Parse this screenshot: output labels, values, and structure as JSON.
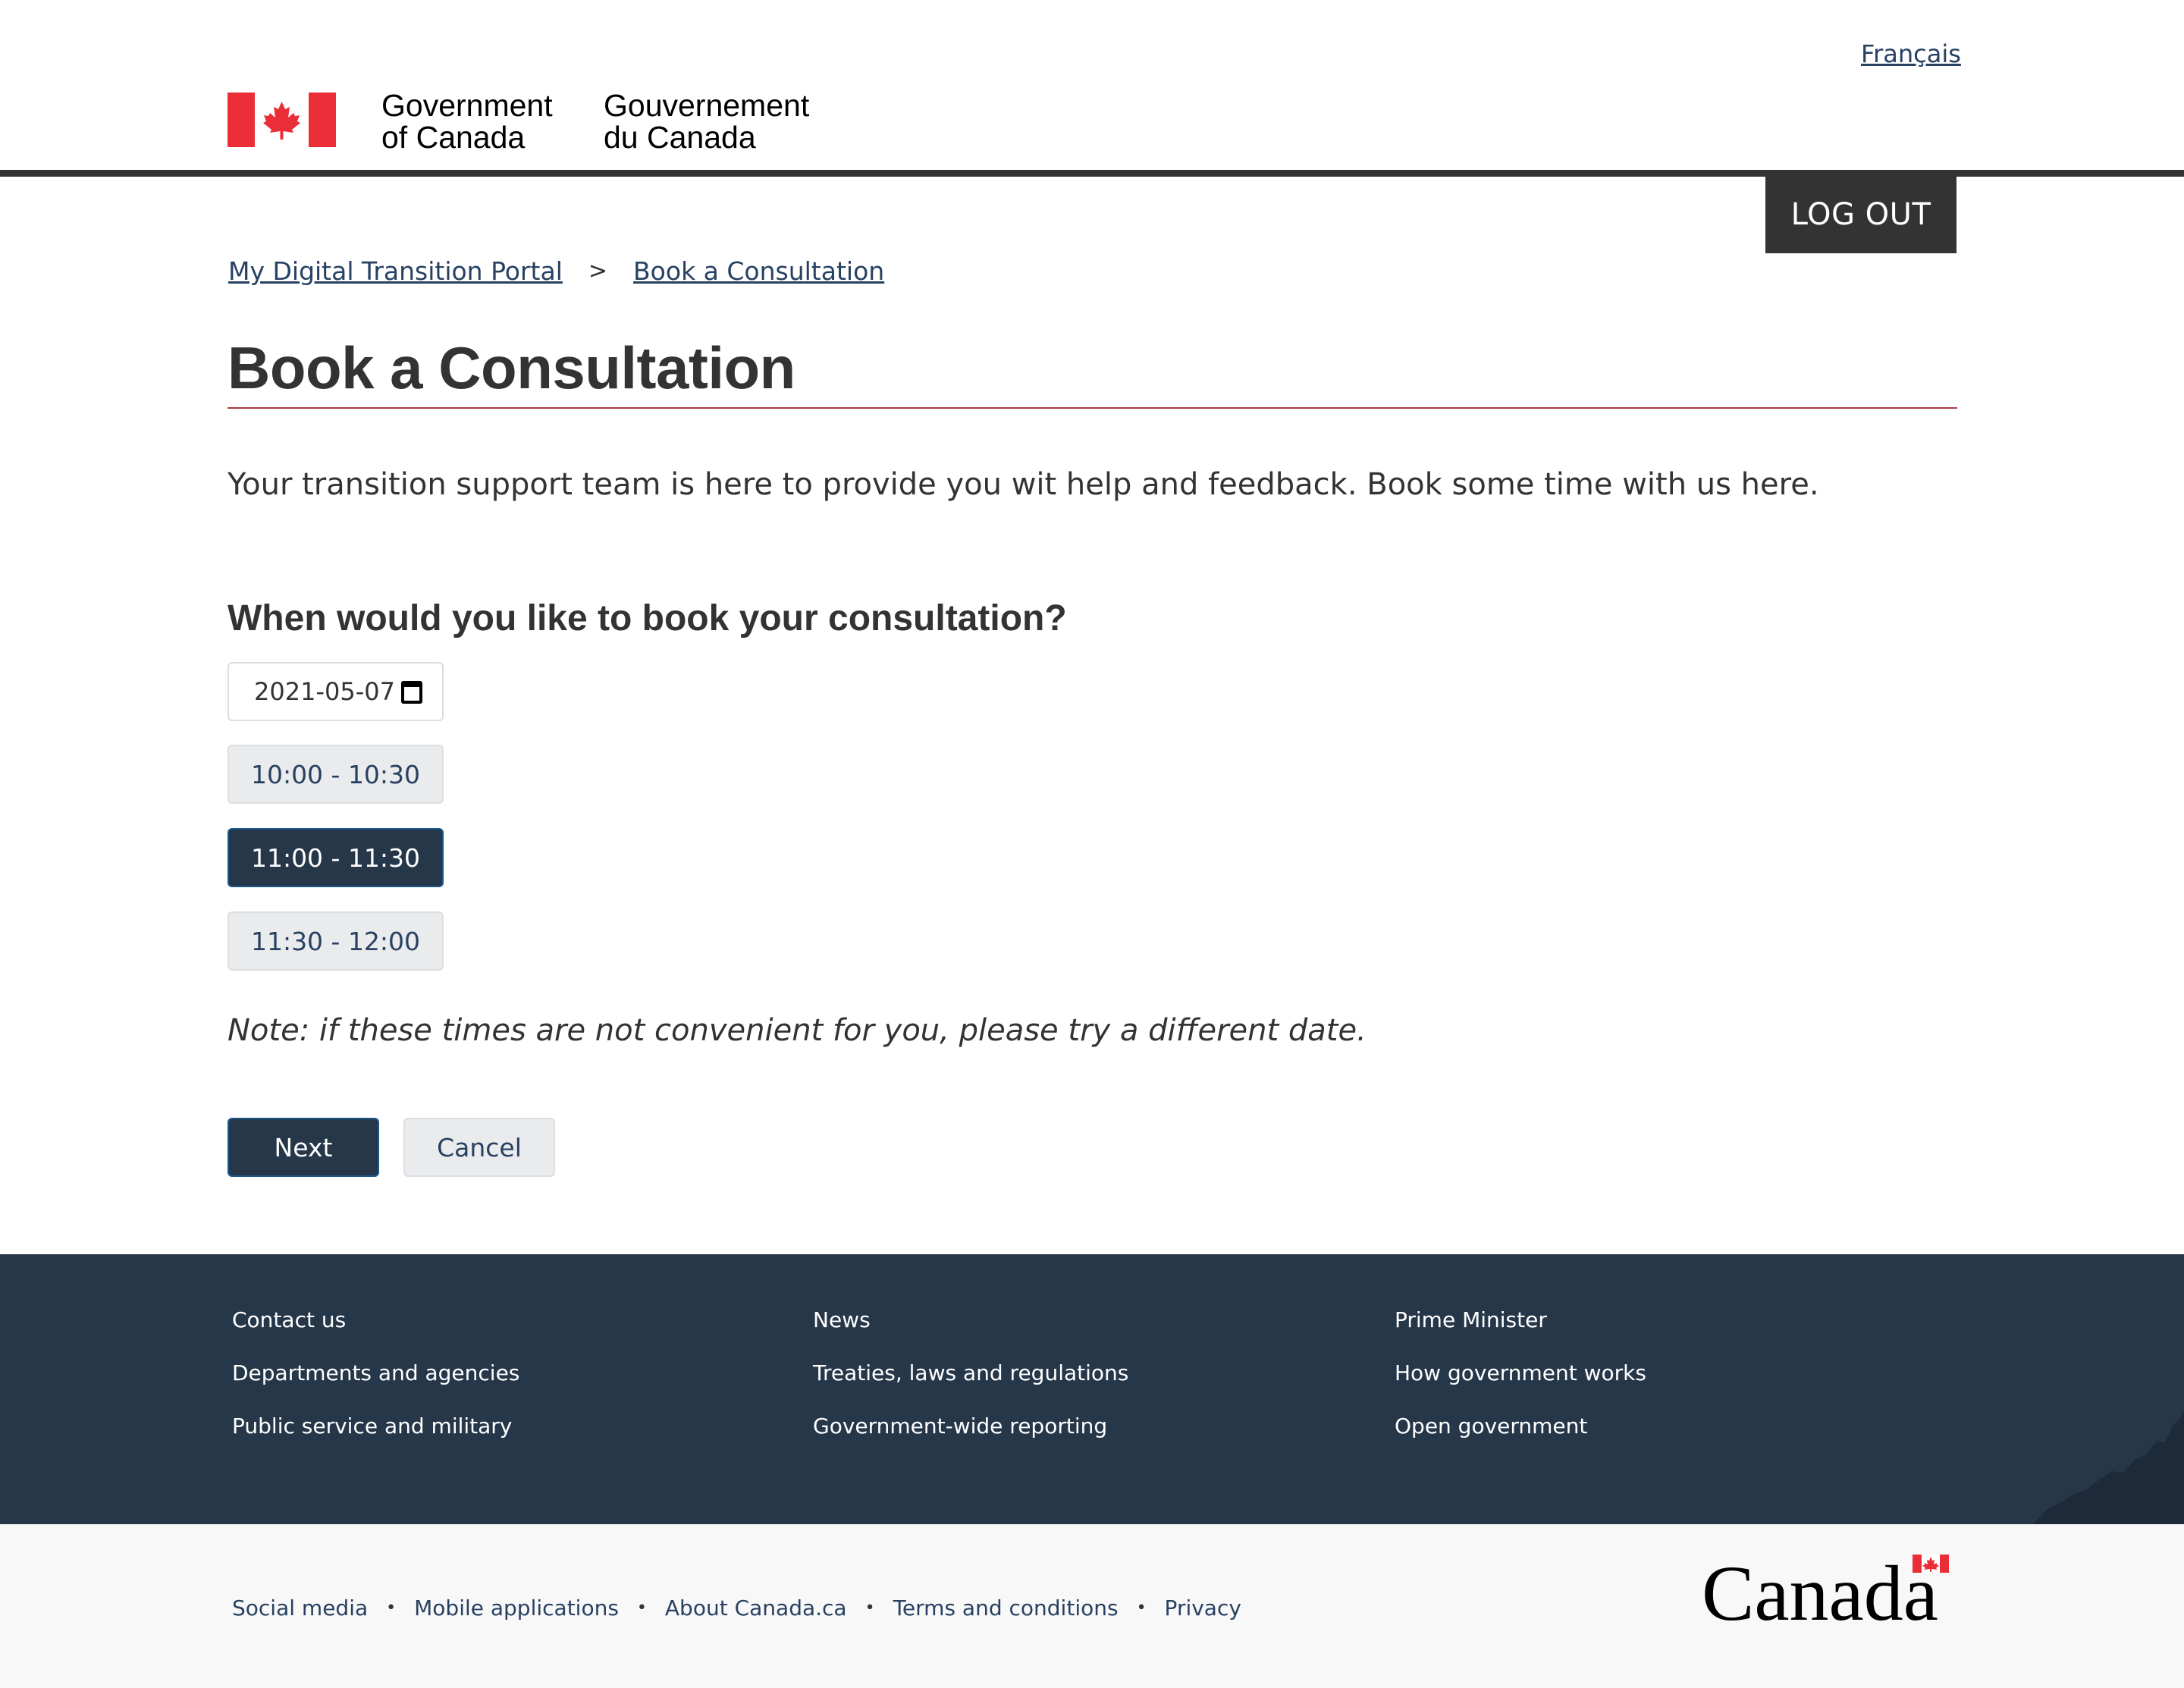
{
  "header": {
    "language_toggle": "Français",
    "signature_en_line1": "Government",
    "signature_en_line2": "of Canada",
    "signature_fr_line1": "Gouvernement",
    "signature_fr_line2": "du Canada",
    "logout_label": "LOG OUT",
    "flag_red": "#eb2d37"
  },
  "breadcrumb": {
    "items": [
      {
        "label": "My Digital Transition Portal"
      },
      {
        "label": "Book a Consultation"
      }
    ],
    "separator": ">"
  },
  "main": {
    "title": "Book a Consultation",
    "intro": "Your transition support team is here to provide you wit help and feedback.  Book some time with us here.",
    "question": "When would you like to book your consultation?",
    "date_value": "2021-05-07",
    "time_slots": [
      {
        "label": "10:00 - 10:30",
        "selected": false
      },
      {
        "label": "11:00 - 11:30",
        "selected": true
      },
      {
        "label": "11:30 - 12:00",
        "selected": false
      }
    ],
    "note": "Note: if these times are not convenient for you, please try a different date.",
    "next_label": "Next",
    "cancel_label": "Cancel"
  },
  "footer": {
    "columns": [
      [
        "Contact us",
        "Departments and agencies",
        "Public service and military"
      ],
      [
        "News",
        "Treaties, laws and regulations",
        "Government-wide reporting"
      ],
      [
        "Prime Minister",
        "How government works",
        "Open government"
      ]
    ],
    "sub_links": [
      "Social media",
      "Mobile applications",
      "About Canada.ca",
      "Terms and conditions",
      "Privacy"
    ],
    "wordmark": "Canada"
  },
  "colors": {
    "primary_dark": "#26374a",
    "link": "#284162",
    "title_rule": "#af3c43"
  }
}
